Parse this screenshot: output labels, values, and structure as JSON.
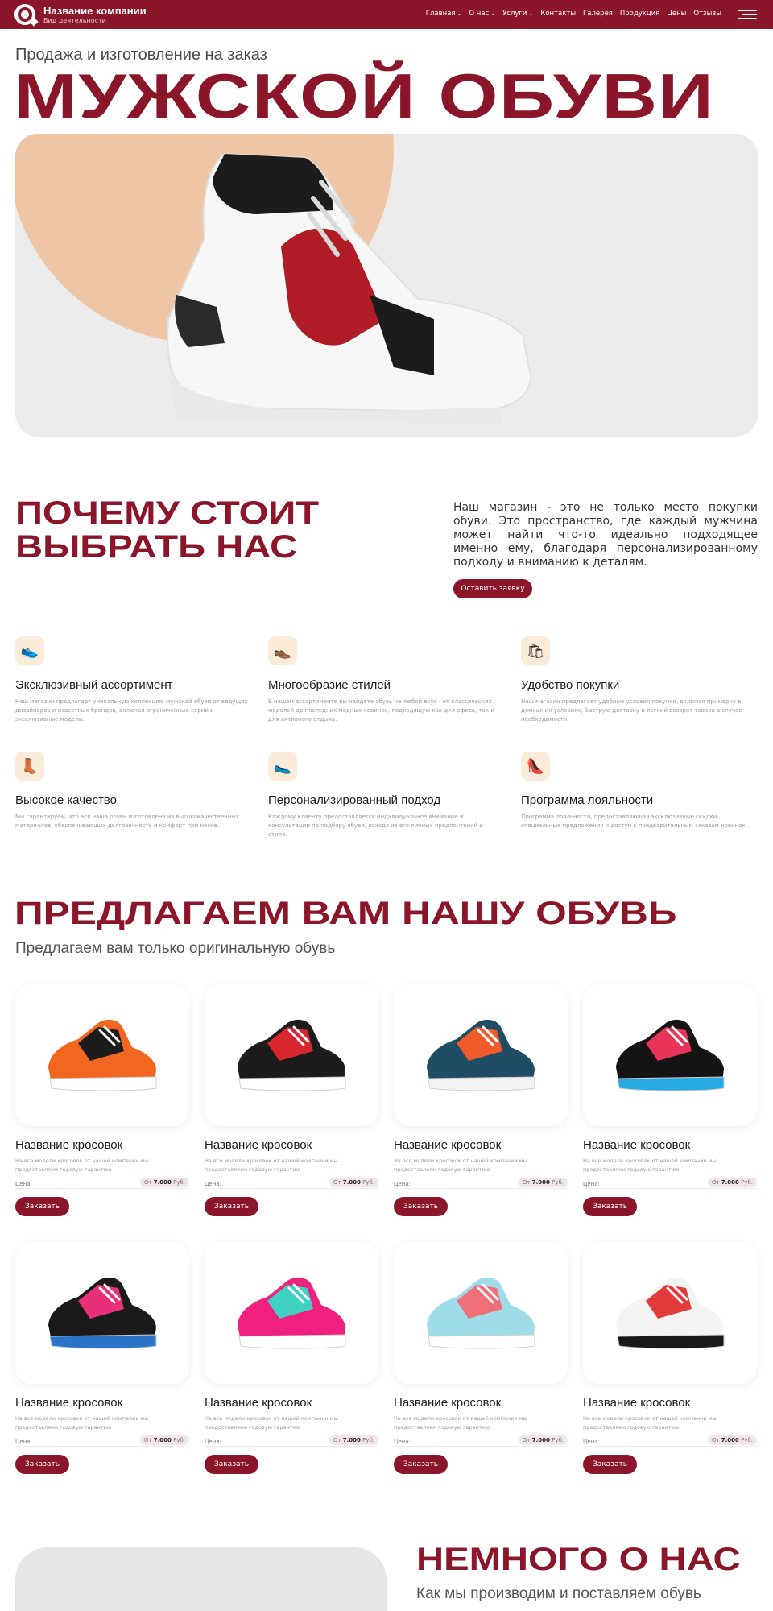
{
  "header": {
    "brand_name": "Название компании",
    "brand_subtitle": "Вид деятельности",
    "nav": [
      {
        "label": "Главная",
        "dropdown": true
      },
      {
        "label": "О нас",
        "dropdown": true
      },
      {
        "label": "Услуги",
        "dropdown": true
      },
      {
        "label": "Контакты",
        "dropdown": false
      },
      {
        "label": "Галерея",
        "dropdown": false
      },
      {
        "label": "Продукция",
        "dropdown": false
      },
      {
        "label": "Цены",
        "dropdown": false
      },
      {
        "label": "Отзывы",
        "dropdown": false
      }
    ],
    "chevron": "⌄",
    "menu_icon": "menu-icon"
  },
  "hero": {
    "subtitle": "Продажа и изготовление на заказ",
    "title": "МУЖСКОЙ ОБУВИ"
  },
  "why": {
    "title_line1": "ПОЧЕМУ СТОИТ",
    "title_line2": "ВЫБРАТЬ НАС",
    "text": "Наш магазин - это не только место покупки обуви. Это пространство, где каждый мужчина может найти что-то идеально подходящее именно ему, благодаря персонализированному подходу и вниманию к деталям.",
    "button": "Оставить заявку",
    "features": [
      {
        "icon": "sneaker-icon",
        "glyph": "👟",
        "title": "Эксклюзивный ассортимент",
        "desc": "Наш магазин предлагает уникальную коллекцию мужской обуви от ведущих дизайнеров и известных брендов, включая ограниченные серии и эксклюзивные модели."
      },
      {
        "icon": "boot-icon",
        "glyph": "👞",
        "title": "Многообразие стилей",
        "desc": "В нашем ассортименте вы найдете обувь на любой вкус - от классических моделей до последних модных новинок, подходящую как для офиса, так и для активного отдыха."
      },
      {
        "icon": "shoe-bag-icon",
        "glyph": "🛍",
        "title": "Удобство покупки",
        "desc": "Наш магазин предлагает удобные условия покупки, включая примерку в домашних условиях, быструю доставку и легкий возврат товара в случае необходимости."
      },
      {
        "icon": "quality-shoe-icon",
        "glyph": "👢",
        "title": "Высокое качество",
        "desc": "Мы гарантируем, что вся наша обувь изготовлена из высококачественных материалов, обеспечивающих долговечность и комфорт при носке."
      },
      {
        "icon": "personal-shoe-icon",
        "glyph": "🥿",
        "title": "Персонализированный подход",
        "desc": "Каждому клиенту предоставляется индивидуальное внимание и консультации по подбору обуви, исходя из его личных предпочтений и стиля."
      },
      {
        "icon": "loyalty-shoe-icon",
        "glyph": "👠",
        "title": "Программа лояльности",
        "desc": "Программа лояльности, предоставляющая эксклюзивные скидки, специальные предложения и доступ к предварительным заказам новинок."
      }
    ]
  },
  "products": {
    "title": "ПРЕДЛАГАЕМ ВАМ НАШУ ОБУВЬ",
    "subtitle": "Предлагаем вам только оригинальную обувь",
    "items": [
      {
        "name": "Название кросовок",
        "desc": "На все модели кросовок от нашей компании мы предоставляем годовую гарантию",
        "price_label": "Цена:",
        "price_from": "От",
        "price": "7.000",
        "currency": "Руб.",
        "button": "Заказать",
        "colors": [
          "#f2661f",
          "#1c1c1c",
          "#ffffff"
        ]
      },
      {
        "name": "Название кросовок",
        "desc": "На все модели кросовок от нашей компании мы предоставляем годовую гарантию",
        "price_label": "Цена:",
        "price_from": "От",
        "price": "7.000",
        "currency": "Руб.",
        "button": "Заказать",
        "colors": [
          "#1c1c1c",
          "#d8262e",
          "#ffffff"
        ]
      },
      {
        "name": "Название кросовок",
        "desc": "На все модели кросовок от нашей компании мы предоставляем годовую гарантию",
        "price_label": "Цена:",
        "price_from": "От",
        "price": "7.000",
        "currency": "Руб.",
        "button": "Заказать",
        "colors": [
          "#1f4d66",
          "#ef5b2b",
          "#f2f2f2"
        ]
      },
      {
        "name": "Название кросовок",
        "desc": "На все модели кросовок от нашей компании мы предоставляем годовую гарантию",
        "price_label": "Цена:",
        "price_from": "От",
        "price": "7.000",
        "currency": "Руб.",
        "button": "Заказать",
        "colors": [
          "#141414",
          "#e8345a",
          "#27a9e1"
        ]
      },
      {
        "name": "Название кросовок",
        "desc": "На все модели кросовок от нашей компании мы предоставляем годовую гарантию",
        "price_label": "Цена:",
        "price_from": "От",
        "price": "7.000",
        "currency": "Руб.",
        "button": "Заказать",
        "colors": [
          "#1a1a1a",
          "#e8307a",
          "#2c74c9"
        ]
      },
      {
        "name": "Название кросовок",
        "desc": "На все модели кросовок от нашей компании мы предоставляем годовую гарантию",
        "price_label": "Цена:",
        "price_from": "От",
        "price": "7.000",
        "currency": "Руб.",
        "button": "Заказать",
        "colors": [
          "#f0207e",
          "#3fd1c4",
          "#ffffff"
        ]
      },
      {
        "name": "Название кросовок",
        "desc": "На все модели кросовок от нашей компании мы предоставляем годовую гарантию",
        "price_label": "Цена:",
        "price_from": "От",
        "price": "7.000",
        "currency": "Руб.",
        "button": "Заказать",
        "colors": [
          "#9fdcea",
          "#f0707a",
          "#ffffff"
        ]
      },
      {
        "name": "Название кросовок",
        "desc": "На все модели кросовок от нашей компании мы предоставляем годовую гарантию",
        "price_label": "Цена:",
        "price_from": "От",
        "price": "7.000",
        "currency": "Руб.",
        "button": "Заказать",
        "colors": [
          "#f4f4f4",
          "#e23b3b",
          "#1a1a1a"
        ]
      }
    ]
  },
  "about": {
    "title": "НЕМНОГО О НАС",
    "subtitle": "Как мы производим и поставляем обувь"
  },
  "colors": {
    "brand": "#8b1529",
    "hero_bg": "#ebebeb",
    "hero_accent": "#eec6a5",
    "icon_bg": "#fbecd9"
  }
}
